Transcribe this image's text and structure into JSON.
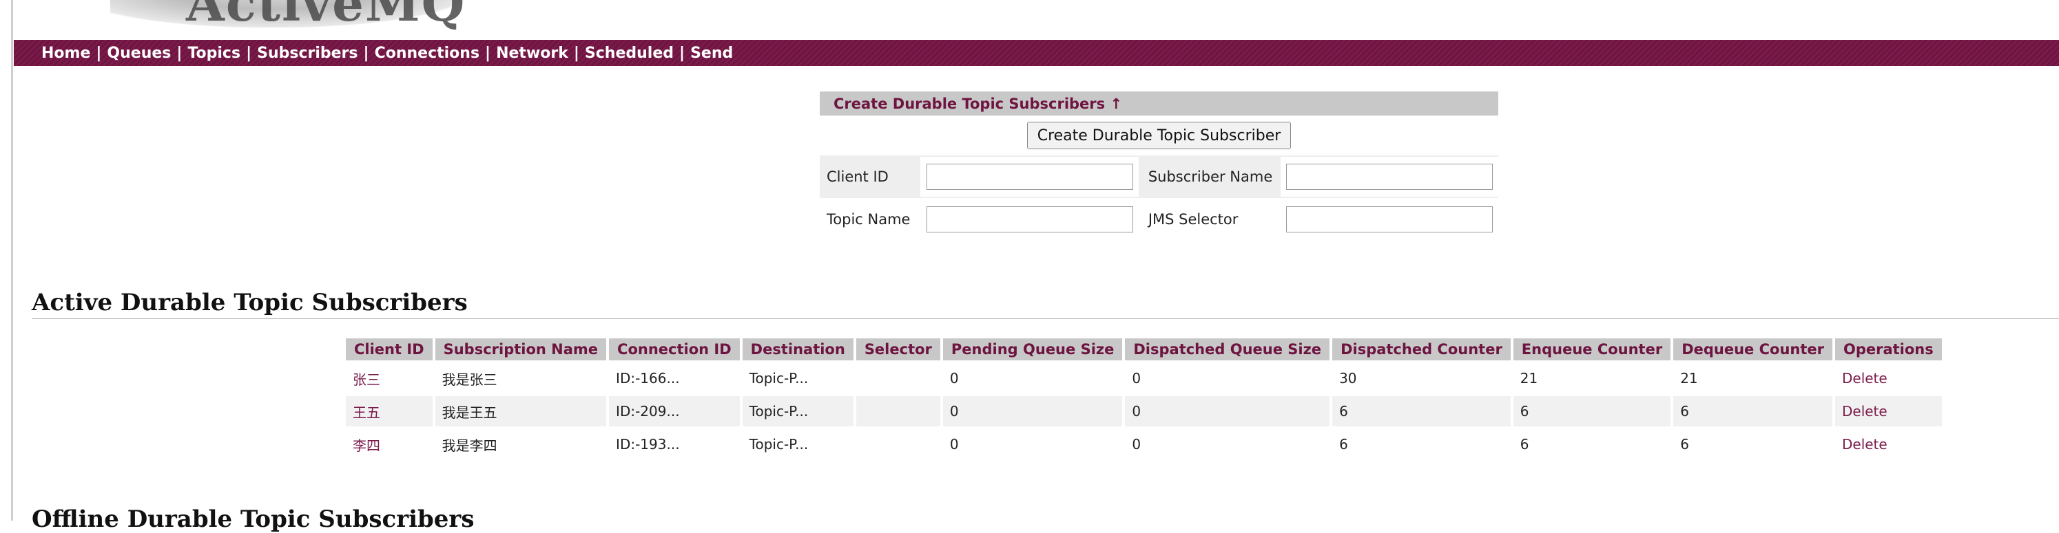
{
  "nav": {
    "items": [
      "Home",
      "Queues",
      "Topics",
      "Subscribers",
      "Connections",
      "Network",
      "Scheduled",
      "Send"
    ]
  },
  "create_form": {
    "header": "Create Durable Topic Subscribers ↑",
    "button_label": "Create Durable Topic Subscriber",
    "client_id_label": "Client ID",
    "subscriber_name_label": "Subscriber Name",
    "topic_name_label": "Topic Name",
    "jms_selector_label": "JMS Selector",
    "client_id_value": "",
    "subscriber_name_value": "",
    "topic_name_value": "",
    "jms_selector_value": ""
  },
  "active": {
    "title": "Active Durable Topic Subscribers",
    "columns": [
      "Client ID",
      "Subscription Name",
      "Connection ID",
      "Destination",
      "Selector",
      "Pending Queue Size",
      "Dispatched Queue Size",
      "Dispatched Counter",
      "Enqueue Counter",
      "Dequeue Counter",
      "Operations"
    ],
    "rows": [
      [
        "张三",
        "我是张三",
        "ID:-166...",
        "Topic-P...",
        "",
        "0",
        "0",
        "30",
        "21",
        "21",
        "Delete"
      ],
      [
        "王五",
        "我是王五",
        "ID:-209...",
        "Topic-P...",
        "",
        "0",
        "0",
        "6",
        "6",
        "6",
        "Delete"
      ],
      [
        "李四",
        "我是李四",
        "ID:-193...",
        "Topic-P...",
        "",
        "0",
        "0",
        "6",
        "6",
        "6",
        "Delete"
      ]
    ]
  },
  "offline": {
    "title": "Offline Durable Topic Subscribers"
  }
}
